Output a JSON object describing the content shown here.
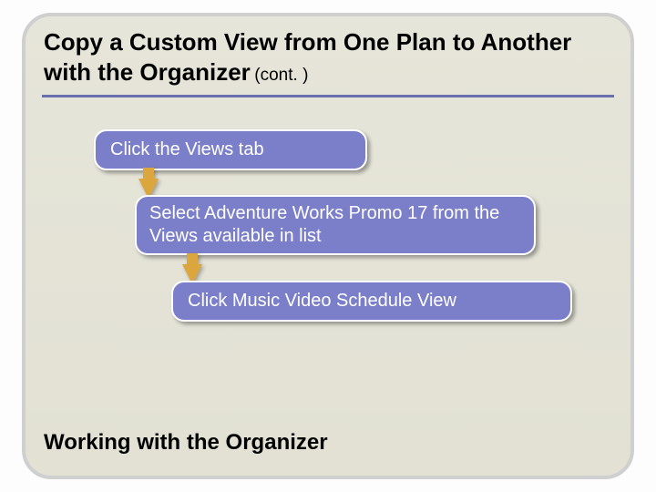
{
  "title": {
    "main": "Copy a Custom View from One Plan to Another with the Organizer",
    "cont": " (cont. )"
  },
  "steps": {
    "s1": "Click the Views tab",
    "s2": "Select Adventure Works Promo 17 from the Views available in list",
    "s3": "Click Music Video Schedule View"
  },
  "footer": "Working with the Organizer"
}
